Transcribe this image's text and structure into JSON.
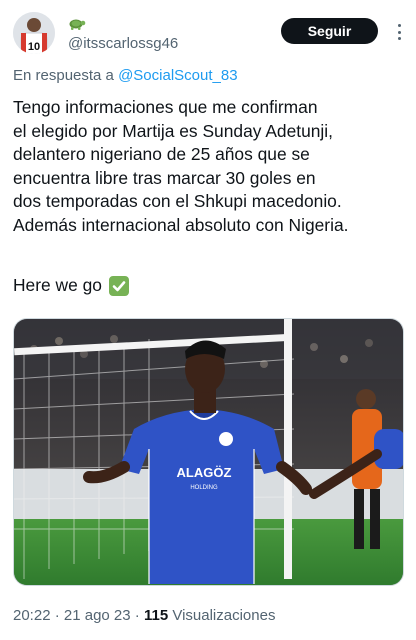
{
  "user": {
    "handle": "@itsscarlossg46",
    "jersey_number": "10"
  },
  "follow_label": "Seguir",
  "reply": {
    "prefix": "En respuesta a ",
    "to": "@SocialScout_83"
  },
  "tweet": {
    "lines": [
      "Tengo informaciones que me confirman",
      "el elegido por Martija es Sunday Adetunji,",
      "delantero nigeriano de 25 años que se",
      "encuentra libre tras marcar 30 goles en",
      "dos temporadas con el Shkupi macedonio.",
      "Además internacional absoluto con Nigeria."
    ],
    "extra": "Here we go"
  },
  "media": {
    "sponsor": "ALAGÖZ",
    "sponsor_sub": "HOLDING"
  },
  "meta": {
    "time": "20:22",
    "sep1": " · ",
    "date": "21 ago 23",
    "sep2": " · ",
    "views_count": "115",
    "views_label": " Visualizaciones"
  },
  "colors": {
    "link": "#1d9bf0",
    "muted": "#536471",
    "text": "#0f1419",
    "jersey": "#2f53c6",
    "check": "#77b255"
  },
  "icons": {
    "name_emoji": "turtle-icon",
    "check_emoji": "check-mark-button-icon",
    "more": "more-options-icon"
  }
}
